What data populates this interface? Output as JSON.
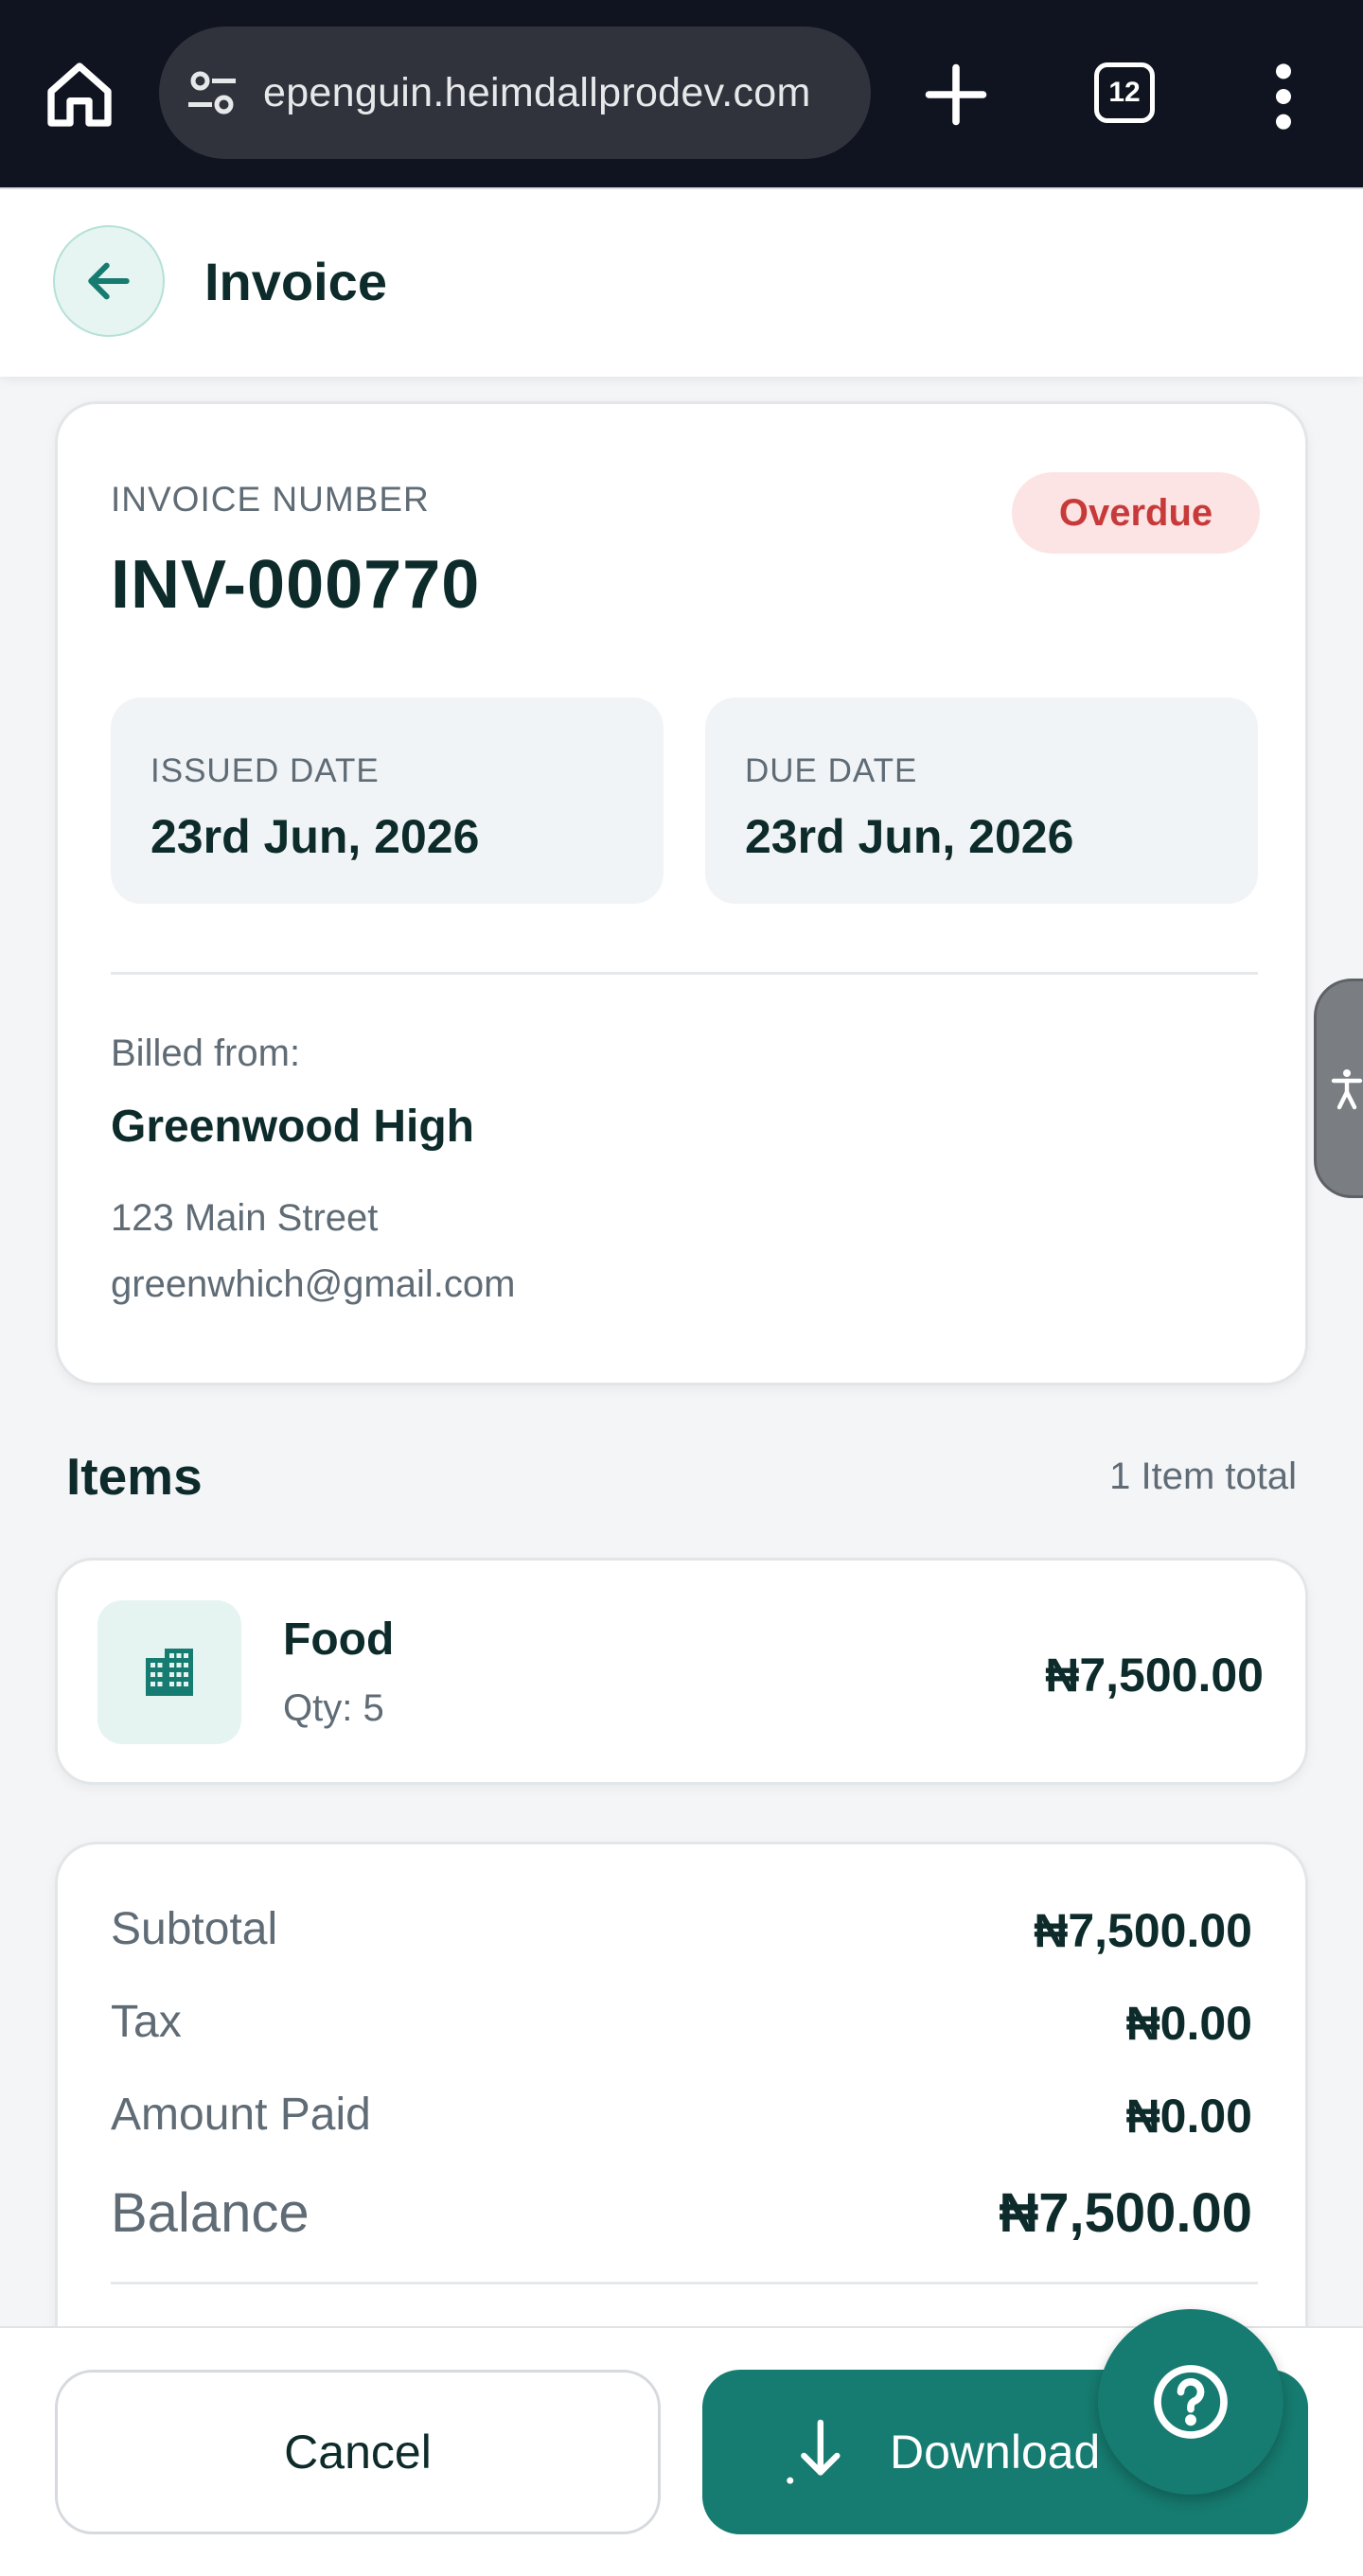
{
  "browser": {
    "url": "epenguin.heimdallprodev.com",
    "tab_count": "12"
  },
  "header": {
    "title": "Invoice"
  },
  "invoice": {
    "number_label": "INVOICE NUMBER",
    "number": "INV-000770",
    "status": "Overdue",
    "issued_label": "ISSUED DATE",
    "issued_date": "23rd Jun, 2026",
    "due_label": "DUE DATE",
    "due_date": "23rd Jun, 2026",
    "billed_from_label": "Billed from:",
    "billed_from_name": "Greenwood High",
    "billed_from_address": "123 Main Street",
    "billed_from_email": "greenwhich@gmail.com"
  },
  "items": {
    "title": "Items",
    "count_text": "1 Item total",
    "list": [
      {
        "name": "Food",
        "qty": "Qty: 5",
        "price": "₦7,500.00",
        "icon": "building-icon"
      }
    ]
  },
  "summary": {
    "subtotal_label": "Subtotal",
    "subtotal": "₦7,500.00",
    "tax_label": "Tax",
    "tax": "₦0.00",
    "paid_label": "Amount Paid",
    "paid": "₦0.00",
    "balance_label": "Balance",
    "balance": "₦7,500.00"
  },
  "actions": {
    "cancel_label": "Cancel",
    "download_label": "Download"
  },
  "colors": {
    "primary": "#167b70",
    "overdue_bg": "#fce4e4",
    "overdue_text": "#c83a3a",
    "text_dark": "#0d2b2a"
  }
}
